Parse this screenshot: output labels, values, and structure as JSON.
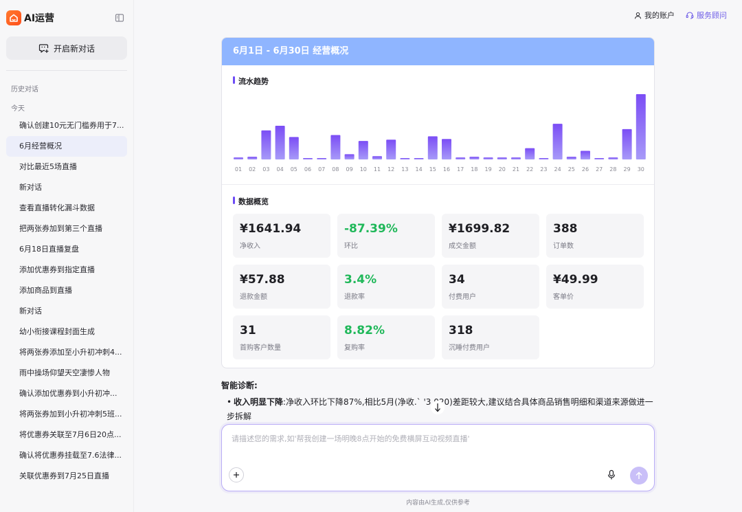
{
  "brand": {
    "name": "AI运营"
  },
  "sidebar": {
    "new_chat_label": "开启新对话",
    "history_label": "历史对话",
    "today_label": "今天",
    "items": [
      {
        "label": "确认创建10元无门槛券用于7...",
        "active": false
      },
      {
        "label": "6月经营概况",
        "active": true
      },
      {
        "label": "对比最近5场直播",
        "active": false
      },
      {
        "label": "新对话",
        "active": false
      },
      {
        "label": "查看直播转化漏斗数据",
        "active": false
      },
      {
        "label": "把两张券加到第三个直播",
        "active": false
      },
      {
        "label": "6月18日直播复盘",
        "active": false
      },
      {
        "label": "添加优惠券到指定直播",
        "active": false
      },
      {
        "label": "添加商品到直播",
        "active": false
      },
      {
        "label": "新对话",
        "active": false
      },
      {
        "label": "幼小衔接课程封面生成",
        "active": false
      },
      {
        "label": "将两张券添加至小升初冲刺4...",
        "active": false
      },
      {
        "label": "雨中操场仰望天空凄惨人物",
        "active": false
      },
      {
        "label": "确认添加优惠券到小升初冲...",
        "active": false
      },
      {
        "label": "将两张券加到小升初冲刺5班...",
        "active": false
      },
      {
        "label": "将优惠券关联至7月6日20点...",
        "active": false
      },
      {
        "label": "确认将优惠券挂载至7.6法律...",
        "active": false
      },
      {
        "label": "关联优惠券到7月25日直播",
        "active": false
      }
    ]
  },
  "topbar": {
    "account_label": "我的账户",
    "service_label": "服务顾问"
  },
  "report": {
    "title": "6月1日 - 6月30日 经营概况",
    "trend_title": "流水趋势",
    "overview_title": "数据概览"
  },
  "chart_data": {
    "type": "bar",
    "title": "流水趋势",
    "categories": [
      "01",
      "02",
      "03",
      "04",
      "05",
      "06",
      "07",
      "08",
      "09",
      "10",
      "11",
      "12",
      "13",
      "14",
      "15",
      "16",
      "17",
      "18",
      "19",
      "20",
      "21",
      "22",
      "23",
      "24",
      "25",
      "26",
      "27",
      "28",
      "29",
      "30"
    ],
    "values": [
      3,
      4,
      44,
      51,
      34,
      2,
      2,
      37,
      8,
      28,
      5,
      30,
      2,
      2,
      35,
      31,
      3,
      4,
      3,
      3,
      3,
      17,
      2,
      54,
      4,
      13,
      2,
      3,
      46,
      99
    ],
    "ylim": [
      0,
      100
    ],
    "grid": false,
    "color_top": "#7b4df5",
    "color_bottom": "#a79af8"
  },
  "metrics": [
    {
      "value": "¥1641.94",
      "label": "净收入",
      "green": false
    },
    {
      "value": "-87.39%",
      "label": "环比",
      "green": true
    },
    {
      "value": "¥1699.82",
      "label": "成交金额",
      "green": false
    },
    {
      "value": "388",
      "label": "订单数",
      "green": false
    },
    {
      "value": "¥57.88",
      "label": "退款金额",
      "green": false
    },
    {
      "value": "3.4%",
      "label": "退款率",
      "green": true
    },
    {
      "value": "34",
      "label": "付费用户",
      "green": false
    },
    {
      "value": "¥49.99",
      "label": "客单价",
      "green": false
    },
    {
      "value": "31",
      "label": "首购客户数量",
      "green": false
    },
    {
      "value": "8.82%",
      "label": "复购率",
      "green": true
    },
    {
      "value": "318",
      "label": "沉睡付费用户",
      "green": false
    }
  ],
  "diagnosis": {
    "title": "智能诊断:",
    "bullet_strong": "收入明显下降",
    "bullet_text": ":净收入环比下降87%,相比5月(净收.`  '3,020)差距较大,建议结合具体商品销售明细和渠道来源做进一步拆解"
  },
  "composer": {
    "placeholder": "请描述您的需求,如'帮我创建一场明晚8点开始的免费横屏互动视频直播'"
  },
  "footer": {
    "note": "内容由AI生成,仅供参考"
  }
}
